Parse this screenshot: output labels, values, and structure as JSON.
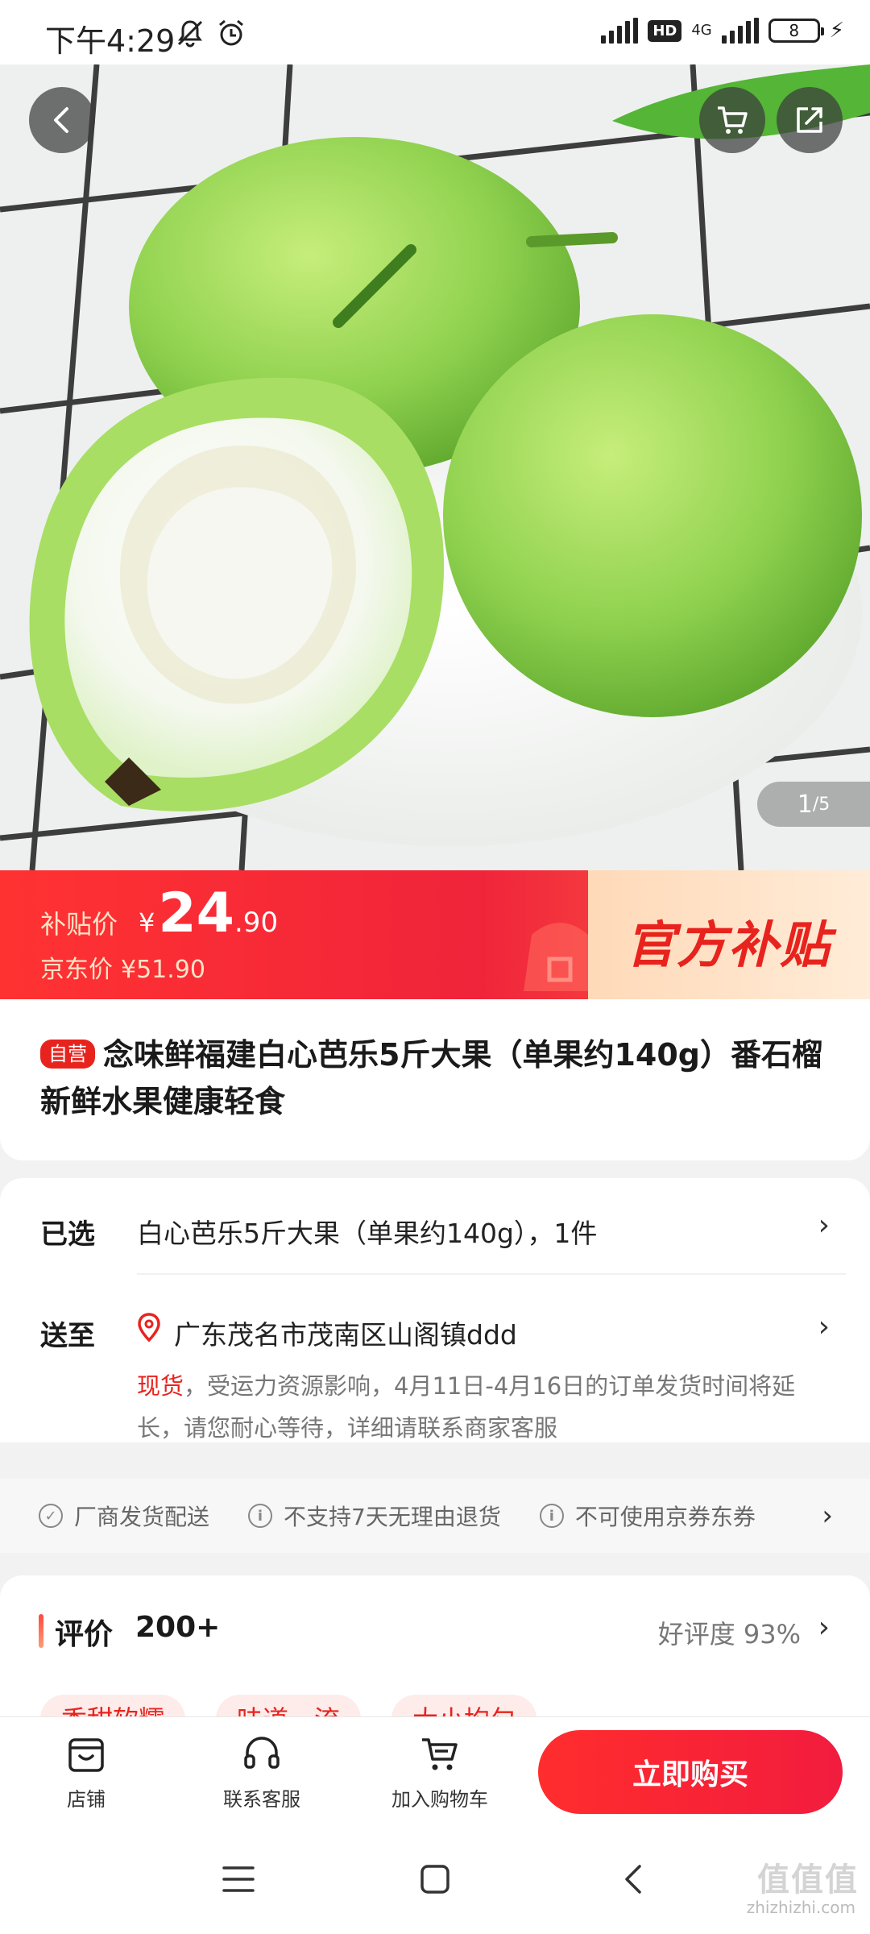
{
  "status_bar": {
    "time": "下午4:29",
    "network": "4G",
    "hd": "HD",
    "battery": "8"
  },
  "gallery": {
    "counter_current": "1",
    "counter_total": "/5",
    "image_subject": "guava fruit on white plate"
  },
  "price": {
    "subsidy_label": "补贴价",
    "currency": "¥",
    "subsidy_int": "24",
    "subsidy_dec": ".90",
    "jd_label": "京东价",
    "jd_price": "¥51.90",
    "official_subsidy": "官方补贴"
  },
  "product": {
    "badge": "自营",
    "title": "念味鲜福建白心芭乐5斤大果（单果约140g）番石榴 新鲜水果健康轻食"
  },
  "selection": {
    "selected_label": "已选",
    "selected_value": "白心芭乐5斤大果（单果约140g），1件",
    "ship_label": "送至",
    "address": "广东茂名市茂南区山阁镇ddd",
    "notice_highlight": "现货",
    "notice_text": "，受运力资源影响，4月11日-4月16日的订单发货时间将延长，请您耐心等待，详细请联系商家客服"
  },
  "services": {
    "item1": "厂商发货配送",
    "item2": "不支持7天无理由退货",
    "item3": "不可使用京券东券"
  },
  "reviews": {
    "title": "评价",
    "count": "200+",
    "rate": "好评度 93%",
    "tags": [
      "香甜软糯",
      "味道一流",
      "大小均匀"
    ]
  },
  "actions": {
    "store": "店铺",
    "service": "联系客服",
    "cart": "加入购物车",
    "buy": "立即购买"
  },
  "watermark": {
    "logo": "值值值",
    "site": "zhizhizhi.com"
  },
  "colors": {
    "accent": "#e8231e",
    "banner_start": "#ff3232",
    "guava_green": "#8fd14f"
  }
}
